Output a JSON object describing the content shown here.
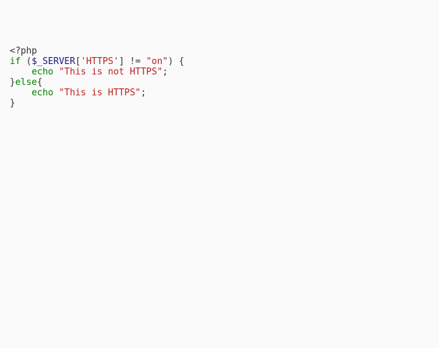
{
  "code": {
    "l1": {
      "open": "<?php"
    },
    "l2": {
      "kw_if": "if",
      "sp1": " (",
      "var": "$_SERVER",
      "br1": "[",
      "str_https_key": "'HTTPS'",
      "br2": "]",
      "sp2": " ",
      "op": "!=",
      "sp3": " ",
      "str_on": "\"on\"",
      "paren": ")",
      "sp4": " {",
      "brace": ""
    },
    "l3": {
      "indent": "    ",
      "kw_echo": "echo",
      "sp": " ",
      "str": "\"This is not HTTPS\"",
      "semi": ";"
    },
    "l4": {
      "close": "}",
      "kw_else": "else",
      "open": "{"
    },
    "l5": {
      "indent": "    ",
      "kw_echo": "echo",
      "sp": " ",
      "str": "\"This is HTTPS\"",
      "semi": ";"
    },
    "l6": {
      "close": "}"
    }
  }
}
